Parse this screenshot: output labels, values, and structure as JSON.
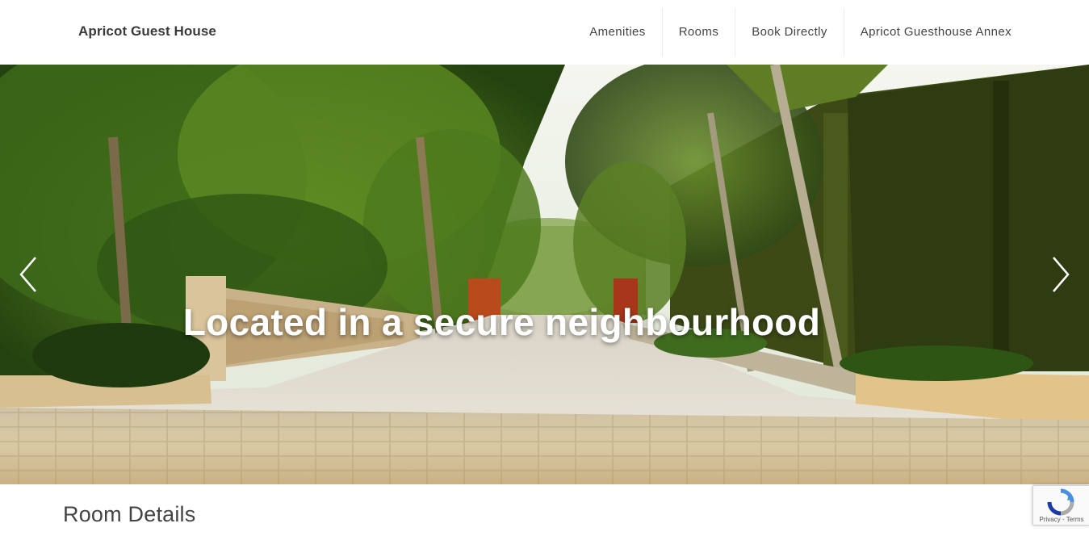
{
  "header": {
    "brand": "Apricot Guest House",
    "nav": [
      "Amenities",
      "Rooms",
      "Book Directly",
      "Apricot Guesthouse Annex"
    ]
  },
  "hero": {
    "title": "Located in a secure neighbourhood",
    "prev_icon": "chevron-left-icon",
    "next_icon": "chevron-right-icon",
    "image": "garden path lined with palm trees"
  },
  "section": {
    "title": "Room Details"
  },
  "recaptcha": {
    "terms": "Privacy - Terms",
    "icon": "recaptcha-icon"
  },
  "colors": {
    "header_bg": "#ffffff",
    "brand_text": "#3a3a3a",
    "nav_text": "#444444",
    "hero_text": "#ffffff"
  }
}
